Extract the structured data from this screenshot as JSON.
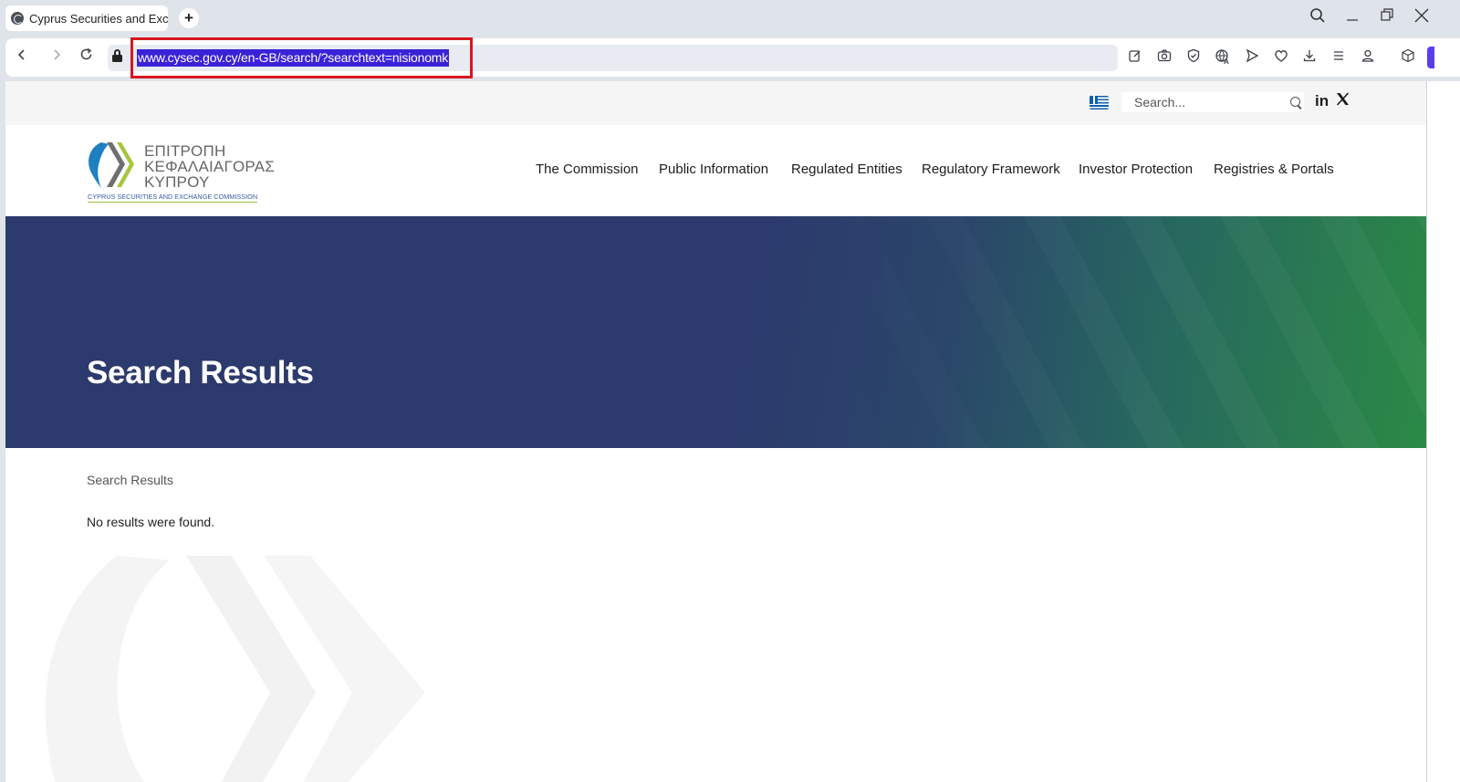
{
  "browser": {
    "tab_title": "Cyprus Securities and Exchange Commission",
    "new_tab_label": "+",
    "url": "www.cysec.gov.cy/en-GB/search/?searchtext=nisionomk",
    "toolbar_icons": [
      "edit-icon",
      "camera-icon",
      "shield-icon",
      "translate-icon",
      "send-icon",
      "heart-icon",
      "download-icon",
      "menu-icon",
      "profile-icon",
      "extensions-icon"
    ]
  },
  "utility_bar": {
    "language_flag": "greek-flag-icon",
    "search_placeholder": "Search...",
    "social": {
      "linkedin": "in",
      "x": "𝕏"
    }
  },
  "logo": {
    "greek_line1": "ΕΠΙΤΡΟΠΗ",
    "greek_line2": "ΚΕΦΑΛΑΙΑΓΟΡΑΣ",
    "greek_line3": "ΚΥΠΡΟΥ",
    "english": "CYPRUS SECURITIES AND EXCHANGE COMMISSION"
  },
  "nav": {
    "items": [
      "The Commission",
      "Public Information",
      "Regulated Entities",
      "Regulatory Framework",
      "Investor Protection",
      "Registries & Portals"
    ]
  },
  "hero": {
    "title": "Search Results"
  },
  "content": {
    "breadcrumb": "Search Results",
    "message": "No results were found."
  },
  "colors": {
    "hero_navy": "#2c3a6d",
    "hero_green": "#2b8a45",
    "url_highlight": "#3a22d8",
    "annotation_red": "#d9161f"
  }
}
